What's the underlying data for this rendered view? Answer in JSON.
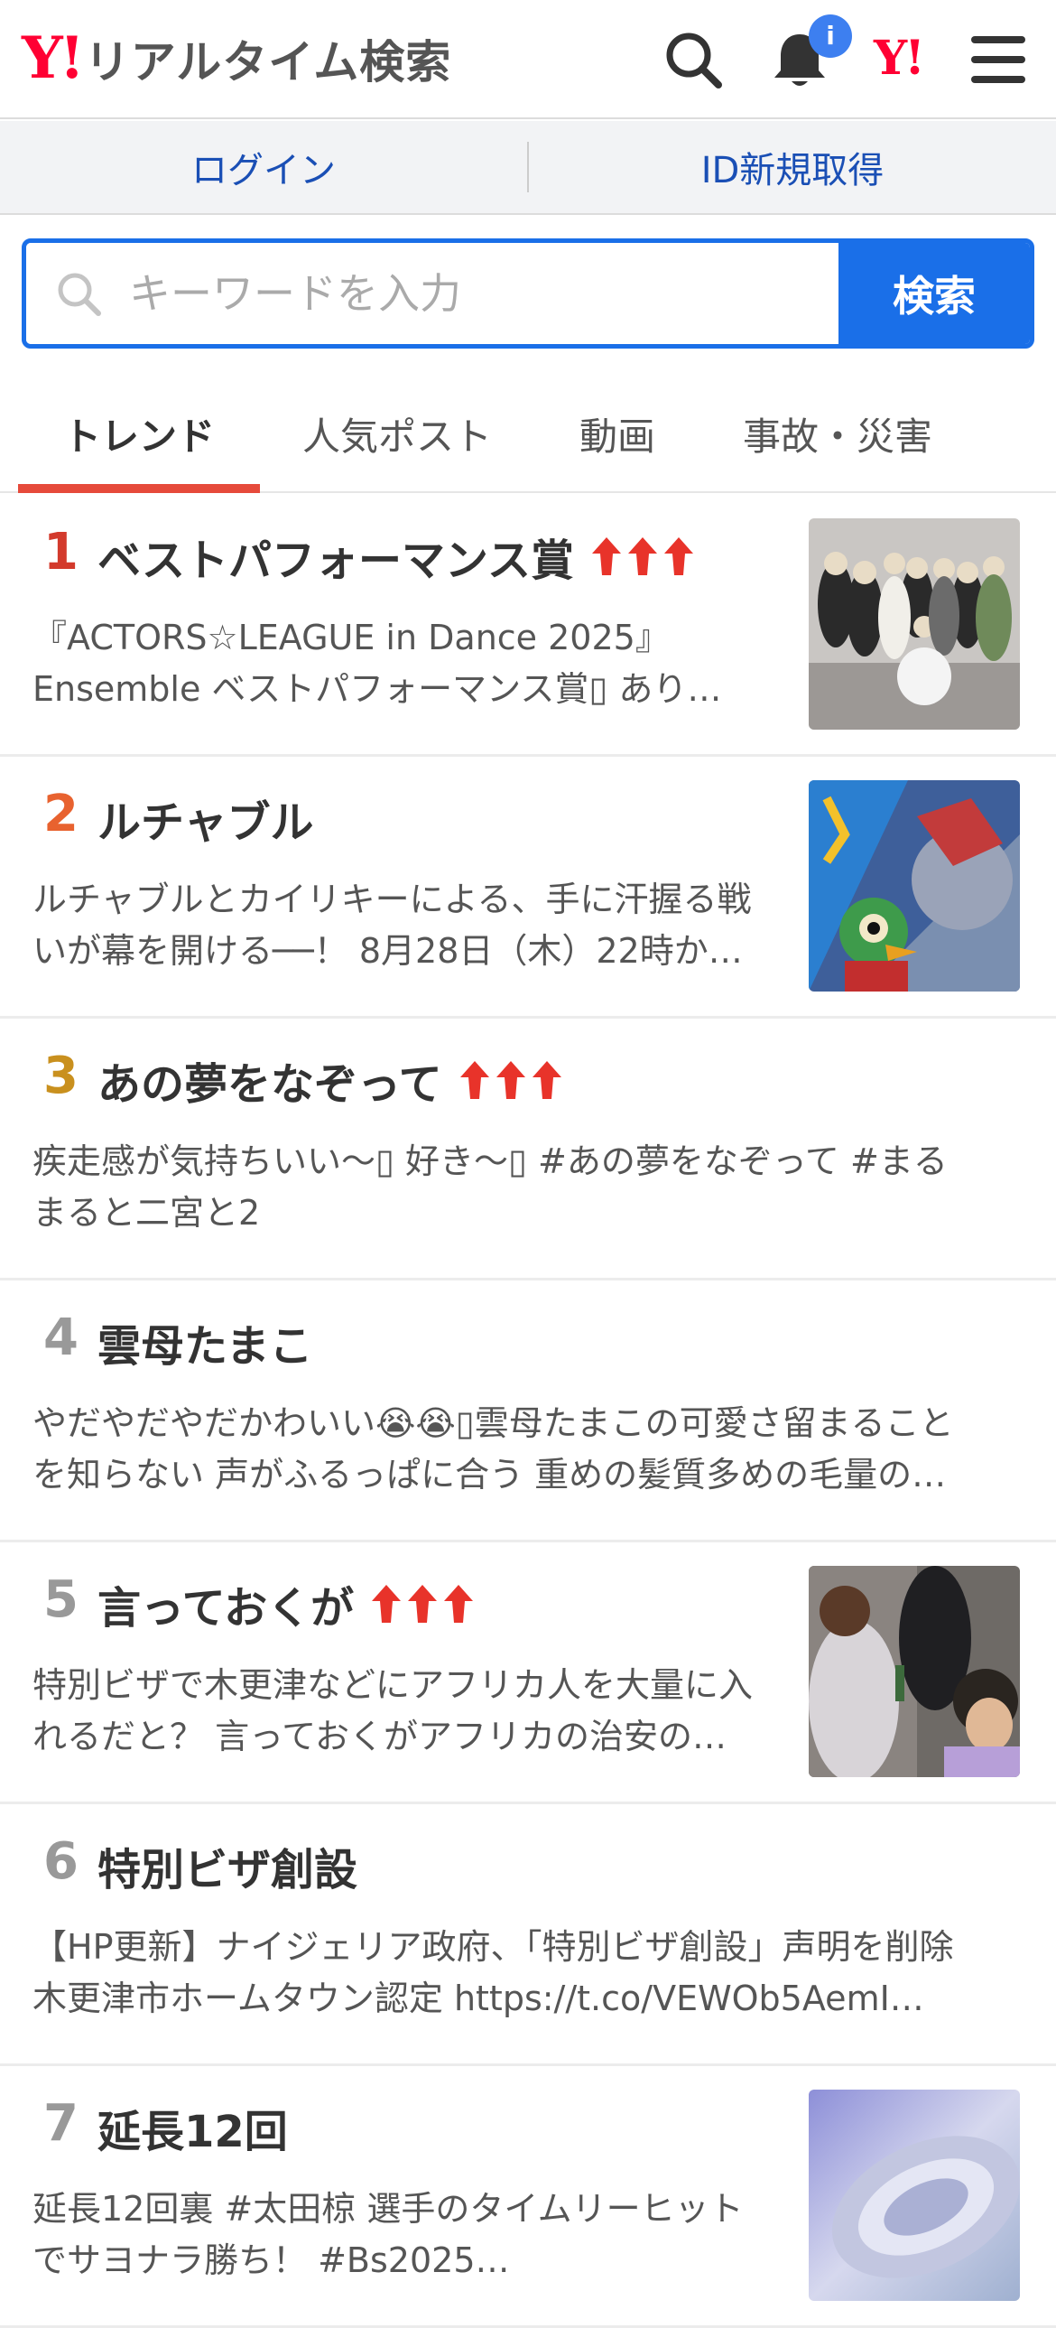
{
  "header": {
    "logo_mark": "Y!",
    "logo_text": "リアルタイム検索",
    "notification_badge": "i",
    "brand_mark": "Y!"
  },
  "account": {
    "login": "ログイン",
    "signup": "ID新規取得"
  },
  "search": {
    "placeholder": "キーワードを入力",
    "button": "検索"
  },
  "tabs": [
    {
      "label": "トレンド",
      "active": true
    },
    {
      "label": "人気ポスト",
      "active": false
    },
    {
      "label": "動画",
      "active": false
    },
    {
      "label": "事故・災害",
      "active": false
    }
  ],
  "trends": [
    {
      "rank": "1",
      "title": "ベストパフォーマンス賞",
      "hot": true,
      "has_thumb": true,
      "line1": "『ACTORS☆LEAGUE in Dance 2025』",
      "line2": "Ensemble ベストパフォーマンス賞▯ あり…"
    },
    {
      "rank": "2",
      "title": "ルチャブル",
      "hot": false,
      "has_thumb": true,
      "line1": "ルチャブルとカイリキーによる、手に汗握る戦",
      "line2": "いが幕を開ける──！ 8月28日（木）22時か…"
    },
    {
      "rank": "3",
      "title": "あの夢をなぞって",
      "hot": true,
      "has_thumb": false,
      "line1": "疾走感が気持ちいい〜▯ 好き〜▯ #あの夢をなぞって #まる",
      "line2": "まると二宮と2"
    },
    {
      "rank": "4",
      "title": "雲母たまこ",
      "hot": false,
      "has_thumb": false,
      "line1": "やだやだやだかわいい😭😭▯雲母たまこの可愛さ留まること",
      "line2": "を知らない 声がふるっぱに合う 重めの髪質多めの毛量の…"
    },
    {
      "rank": "5",
      "title": "言っておくが",
      "hot": true,
      "has_thumb": true,
      "line1": "特別ビザで木更津などにアフリカ人を大量に入",
      "line2": "れるだと？ 言っておくがアフリカの治安の…"
    },
    {
      "rank": "6",
      "title": "特別ビザ創設",
      "hot": false,
      "has_thumb": false,
      "line1": "【HP更新】ナイジェリア政府、「特別ビザ創設」声明を削除",
      "line2": "木更津市ホームタウン認定 https://t.co/VEWOb5AemI…"
    },
    {
      "rank": "7",
      "title": "延長12回",
      "hot": false,
      "has_thumb": true,
      "line1": "延長12回裏 #太田椋 選手のタイムリーヒット",
      "line2": "でサヨナラ勝ち！ #Bs2025…"
    }
  ],
  "colors": {
    "brand_red": "#ff0033",
    "link_blue": "#1a4fb5",
    "search_blue": "#1a6fe8",
    "tab_underline": "#e64a3b",
    "rank1": "#d33a2c",
    "rank2": "#e8622f",
    "rank3": "#c9901e",
    "rank_other": "#999999",
    "hot_arrow": "#e8332a"
  }
}
